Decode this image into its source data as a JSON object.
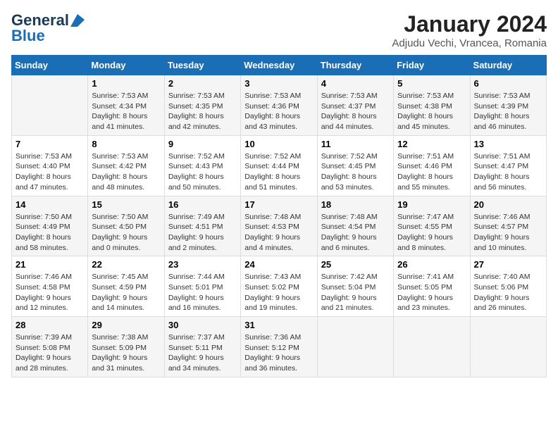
{
  "logo": {
    "line1": "General",
    "line2": "Blue"
  },
  "title": "January 2024",
  "subtitle": "Adjudu Vechi, Vrancea, Romania",
  "weekdays": [
    "Sunday",
    "Monday",
    "Tuesday",
    "Wednesday",
    "Thursday",
    "Friday",
    "Saturday"
  ],
  "weeks": [
    [
      {
        "day": "",
        "sunrise": "",
        "sunset": "",
        "daylight": ""
      },
      {
        "day": "1",
        "sunrise": "Sunrise: 7:53 AM",
        "sunset": "Sunset: 4:34 PM",
        "daylight": "Daylight: 8 hours and 41 minutes."
      },
      {
        "day": "2",
        "sunrise": "Sunrise: 7:53 AM",
        "sunset": "Sunset: 4:35 PM",
        "daylight": "Daylight: 8 hours and 42 minutes."
      },
      {
        "day": "3",
        "sunrise": "Sunrise: 7:53 AM",
        "sunset": "Sunset: 4:36 PM",
        "daylight": "Daylight: 8 hours and 43 minutes."
      },
      {
        "day": "4",
        "sunrise": "Sunrise: 7:53 AM",
        "sunset": "Sunset: 4:37 PM",
        "daylight": "Daylight: 8 hours and 44 minutes."
      },
      {
        "day": "5",
        "sunrise": "Sunrise: 7:53 AM",
        "sunset": "Sunset: 4:38 PM",
        "daylight": "Daylight: 8 hours and 45 minutes."
      },
      {
        "day": "6",
        "sunrise": "Sunrise: 7:53 AM",
        "sunset": "Sunset: 4:39 PM",
        "daylight": "Daylight: 8 hours and 46 minutes."
      }
    ],
    [
      {
        "day": "7",
        "sunrise": "Sunrise: 7:53 AM",
        "sunset": "Sunset: 4:40 PM",
        "daylight": "Daylight: 8 hours and 47 minutes."
      },
      {
        "day": "8",
        "sunrise": "Sunrise: 7:53 AM",
        "sunset": "Sunset: 4:42 PM",
        "daylight": "Daylight: 8 hours and 48 minutes."
      },
      {
        "day": "9",
        "sunrise": "Sunrise: 7:52 AM",
        "sunset": "Sunset: 4:43 PM",
        "daylight": "Daylight: 8 hours and 50 minutes."
      },
      {
        "day": "10",
        "sunrise": "Sunrise: 7:52 AM",
        "sunset": "Sunset: 4:44 PM",
        "daylight": "Daylight: 8 hours and 51 minutes."
      },
      {
        "day": "11",
        "sunrise": "Sunrise: 7:52 AM",
        "sunset": "Sunset: 4:45 PM",
        "daylight": "Daylight: 8 hours and 53 minutes."
      },
      {
        "day": "12",
        "sunrise": "Sunrise: 7:51 AM",
        "sunset": "Sunset: 4:46 PM",
        "daylight": "Daylight: 8 hours and 55 minutes."
      },
      {
        "day": "13",
        "sunrise": "Sunrise: 7:51 AM",
        "sunset": "Sunset: 4:47 PM",
        "daylight": "Daylight: 8 hours and 56 minutes."
      }
    ],
    [
      {
        "day": "14",
        "sunrise": "Sunrise: 7:50 AM",
        "sunset": "Sunset: 4:49 PM",
        "daylight": "Daylight: 8 hours and 58 minutes."
      },
      {
        "day": "15",
        "sunrise": "Sunrise: 7:50 AM",
        "sunset": "Sunset: 4:50 PM",
        "daylight": "Daylight: 9 hours and 0 minutes."
      },
      {
        "day": "16",
        "sunrise": "Sunrise: 7:49 AM",
        "sunset": "Sunset: 4:51 PM",
        "daylight": "Daylight: 9 hours and 2 minutes."
      },
      {
        "day": "17",
        "sunrise": "Sunrise: 7:48 AM",
        "sunset": "Sunset: 4:53 PM",
        "daylight": "Daylight: 9 hours and 4 minutes."
      },
      {
        "day": "18",
        "sunrise": "Sunrise: 7:48 AM",
        "sunset": "Sunset: 4:54 PM",
        "daylight": "Daylight: 9 hours and 6 minutes."
      },
      {
        "day": "19",
        "sunrise": "Sunrise: 7:47 AM",
        "sunset": "Sunset: 4:55 PM",
        "daylight": "Daylight: 9 hours and 8 minutes."
      },
      {
        "day": "20",
        "sunrise": "Sunrise: 7:46 AM",
        "sunset": "Sunset: 4:57 PM",
        "daylight": "Daylight: 9 hours and 10 minutes."
      }
    ],
    [
      {
        "day": "21",
        "sunrise": "Sunrise: 7:46 AM",
        "sunset": "Sunset: 4:58 PM",
        "daylight": "Daylight: 9 hours and 12 minutes."
      },
      {
        "day": "22",
        "sunrise": "Sunrise: 7:45 AM",
        "sunset": "Sunset: 4:59 PM",
        "daylight": "Daylight: 9 hours and 14 minutes."
      },
      {
        "day": "23",
        "sunrise": "Sunrise: 7:44 AM",
        "sunset": "Sunset: 5:01 PM",
        "daylight": "Daylight: 9 hours and 16 minutes."
      },
      {
        "day": "24",
        "sunrise": "Sunrise: 7:43 AM",
        "sunset": "Sunset: 5:02 PM",
        "daylight": "Daylight: 9 hours and 19 minutes."
      },
      {
        "day": "25",
        "sunrise": "Sunrise: 7:42 AM",
        "sunset": "Sunset: 5:04 PM",
        "daylight": "Daylight: 9 hours and 21 minutes."
      },
      {
        "day": "26",
        "sunrise": "Sunrise: 7:41 AM",
        "sunset": "Sunset: 5:05 PM",
        "daylight": "Daylight: 9 hours and 23 minutes."
      },
      {
        "day": "27",
        "sunrise": "Sunrise: 7:40 AM",
        "sunset": "Sunset: 5:06 PM",
        "daylight": "Daylight: 9 hours and 26 minutes."
      }
    ],
    [
      {
        "day": "28",
        "sunrise": "Sunrise: 7:39 AM",
        "sunset": "Sunset: 5:08 PM",
        "daylight": "Daylight: 9 hours and 28 minutes."
      },
      {
        "day": "29",
        "sunrise": "Sunrise: 7:38 AM",
        "sunset": "Sunset: 5:09 PM",
        "daylight": "Daylight: 9 hours and 31 minutes."
      },
      {
        "day": "30",
        "sunrise": "Sunrise: 7:37 AM",
        "sunset": "Sunset: 5:11 PM",
        "daylight": "Daylight: 9 hours and 34 minutes."
      },
      {
        "day": "31",
        "sunrise": "Sunrise: 7:36 AM",
        "sunset": "Sunset: 5:12 PM",
        "daylight": "Daylight: 9 hours and 36 minutes."
      },
      {
        "day": "",
        "sunrise": "",
        "sunset": "",
        "daylight": ""
      },
      {
        "day": "",
        "sunrise": "",
        "sunset": "",
        "daylight": ""
      },
      {
        "day": "",
        "sunrise": "",
        "sunset": "",
        "daylight": ""
      }
    ]
  ]
}
